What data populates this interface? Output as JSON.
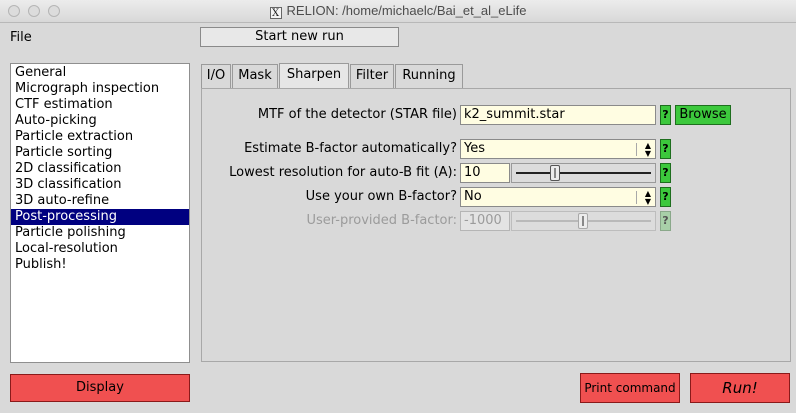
{
  "window": {
    "title": "RELION: /home/michaelc/Bai_et_al_eLife",
    "title_icon": "X"
  },
  "menubar": {
    "file_label": "File",
    "start_new_run_label": "Start new run"
  },
  "processes": [
    "General",
    "Micrograph inspection",
    "CTF estimation",
    "Auto-picking",
    "Particle extraction",
    "Particle sorting",
    "2D classification",
    "3D classification",
    "3D auto-refine",
    "Post-processing",
    "Particle polishing",
    "Local-resolution",
    "Publish!"
  ],
  "selected_process": "Post-processing",
  "tabs": [
    "I/O",
    "Mask",
    "Sharpen",
    "Filter",
    "Running"
  ],
  "active_tab": "Sharpen",
  "sharpen": {
    "mtf_label": "MTF of the detector (STAR file)",
    "mtf_value": "k2_summit.star",
    "browse_label": "Browse",
    "auto_bfactor_label": "Estimate B-factor automatically?",
    "auto_bfactor_value": "Yes",
    "lowest_res_label": "Lowest resolution for auto-B fit (A):",
    "lowest_res_value": "10",
    "own_bfactor_label": "Use your own B-factor?",
    "own_bfactor_value": "No",
    "user_bfactor_label": "User-provided B-factor:",
    "user_bfactor_value": "-1000",
    "help_label": "?"
  },
  "bottom": {
    "display_label": "Display",
    "print_command_label": "Print command",
    "run_label": "Run!"
  },
  "colors": {
    "selection": "#000080",
    "field_bg": "#fffde2",
    "help_green": "#3cc83c",
    "run_red": "#f05050"
  }
}
